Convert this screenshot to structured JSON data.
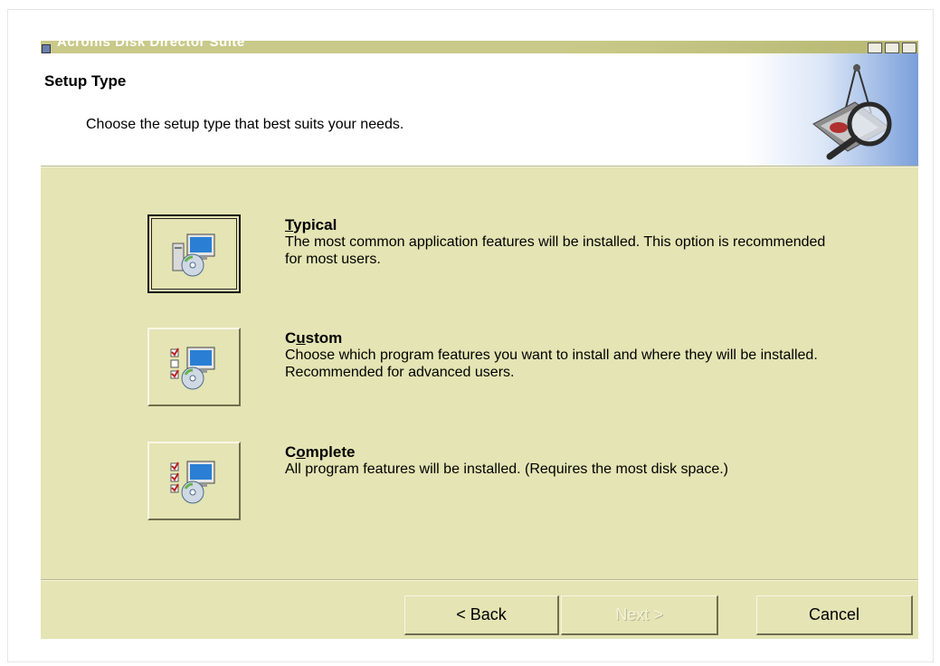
{
  "window": {
    "title": "Acronis Disk Director Suite"
  },
  "header": {
    "title": "Setup Type",
    "description": "Choose the setup type that best suits your needs."
  },
  "options": [
    {
      "key": "T",
      "rest": "ypical",
      "description": "The most common application features will be installed. This option is recommended for most users.",
      "icon": "typical-setup-icon",
      "selected": true
    },
    {
      "key_prefix": "C",
      "key": "u",
      "rest": "stom",
      "description": "Choose which program features you want to install and where they will be installed. Recommended for advanced users.",
      "icon": "custom-setup-icon",
      "selected": false
    },
    {
      "key_prefix": "C",
      "key": "o",
      "rest": "mplete",
      "description": "All program features will be installed. (Requires the most disk space.)",
      "icon": "complete-setup-icon",
      "selected": false
    }
  ],
  "buttons": {
    "back": "< Back",
    "next": "Next >",
    "cancel": "Cancel"
  },
  "colors": {
    "dialog_background": "#e4e4b4",
    "header_background": "#ffffff",
    "header_art_blue": "#7a9fda"
  }
}
